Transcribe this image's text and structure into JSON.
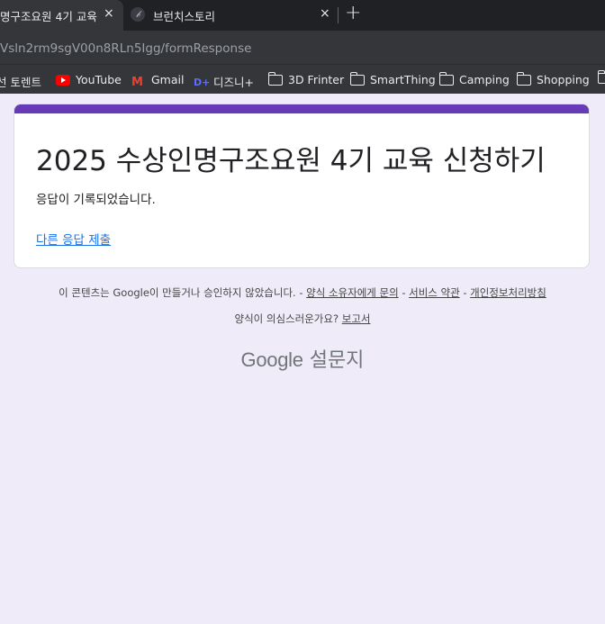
{
  "browser": {
    "tabs": [
      {
        "title": "명구조요원 4기 교육",
        "close": "×"
      },
      {
        "title": "브런치스토리",
        "close": "×",
        "favicon": "𝒷"
      }
    ],
    "new_tab": "+",
    "url": "Vsln2rm9sgV00n8RLn5Igg/formResponse"
  },
  "bookmarks": [
    {
      "label": "선 토렌트",
      "icon": "none"
    },
    {
      "label": "YouTube",
      "icon": "youtube-icon"
    },
    {
      "label": "Gmail",
      "icon": "gmail-icon"
    },
    {
      "label": "디즈니+",
      "icon": "disney-icon"
    },
    {
      "label": "3D Frinter",
      "icon": "folder-icon"
    },
    {
      "label": "SmartThing",
      "icon": "folder-icon"
    },
    {
      "label": "Camping",
      "icon": "folder-icon"
    },
    {
      "label": "Shopping",
      "icon": "folder-icon"
    }
  ],
  "form": {
    "title": "2025 수상인명구조요원 4기 교육 신청하기",
    "confirmation": "응답이 기록되었습니다.",
    "another_response": "다른 응답 제출",
    "accent_color": "#673ab7"
  },
  "footer": {
    "disclaimer": "이 콘텐츠는 Google이 만들거나 승인하지 않았습니다. - ",
    "contact_owner": "양식 소유자에게 문의",
    "sep1": " - ",
    "terms": "서비스 약관",
    "sep2": " - ",
    "privacy": "개인정보처리방침",
    "suspicious": "양식이 의심스러운가요? ",
    "report": "보고서",
    "brand_google": "Google",
    "brand_forms": "설문지"
  }
}
